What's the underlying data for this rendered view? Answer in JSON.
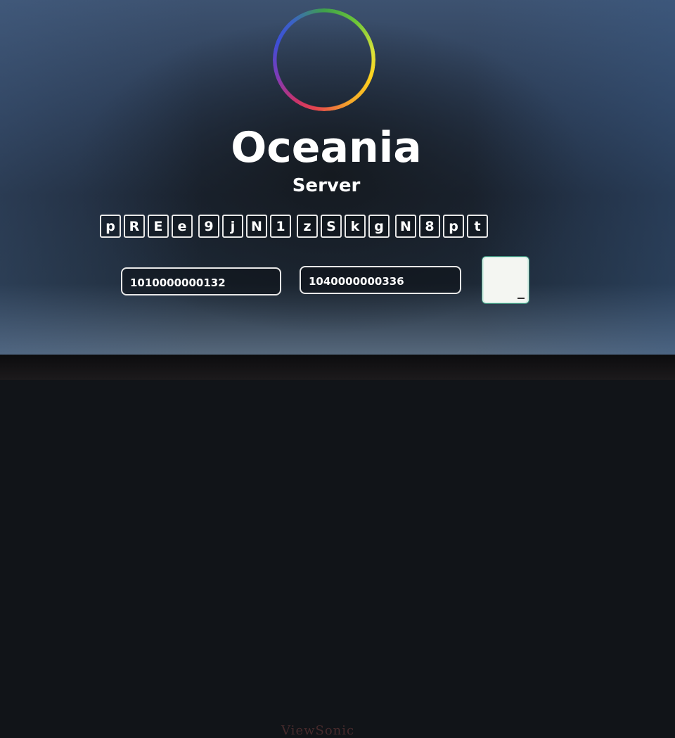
{
  "app": {
    "title": "Oceania",
    "subtitle": "Server"
  },
  "colors": {
    "text": "#ffffff",
    "border": "#e8e8e8"
  },
  "code_chars": [
    "p",
    "R",
    "E",
    "e",
    "9",
    "j",
    "N",
    "1",
    "z",
    "S",
    "k",
    "g",
    "N",
    "8",
    "p",
    "t"
  ],
  "fields": {
    "first_value": "1010000000132",
    "second_value": "1040000000336"
  },
  "monitor": {
    "brand": "ViewSonic"
  }
}
